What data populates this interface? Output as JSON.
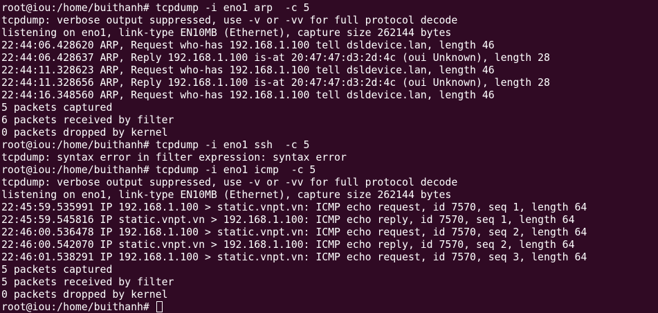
{
  "terminal": {
    "lines": [
      "root@iou:/home/buithanh# tcpdump -i eno1 arp  -c 5",
      "tcpdump: verbose output suppressed, use -v or -vv for full protocol decode",
      "listening on eno1, link-type EN10MB (Ethernet), capture size 262144 bytes",
      "22:44:06.428620 ARP, Request who-has 192.168.1.100 tell dsldevice.lan, length 46",
      "22:44:06.428637 ARP, Reply 192.168.1.100 is-at 20:47:47:d3:2d:4c (oui Unknown), length 28",
      "22:44:11.328623 ARP, Request who-has 192.168.1.100 tell dsldevice.lan, length 46",
      "22:44:11.328656 ARP, Reply 192.168.1.100 is-at 20:47:47:d3:2d:4c (oui Unknown), length 28",
      "22:44:16.348560 ARP, Request who-has 192.168.1.100 tell dsldevice.lan, length 46",
      "5 packets captured",
      "6 packets received by filter",
      "0 packets dropped by kernel",
      "root@iou:/home/buithanh# tcpdump -i eno1 ssh  -c 5",
      "tcpdump: syntax error in filter expression: syntax error",
      "root@iou:/home/buithanh# tcpdump -i eno1 icmp  -c 5",
      "tcpdump: verbose output suppressed, use -v or -vv for full protocol decode",
      "listening on eno1, link-type EN10MB (Ethernet), capture size 262144 bytes",
      "22:45:59.535991 IP 192.168.1.100 > static.vnpt.vn: ICMP echo request, id 7570, seq 1, length 64",
      "22:45:59.545816 IP static.vnpt.vn > 192.168.1.100: ICMP echo reply, id 7570, seq 1, length 64",
      "22:46:00.536478 IP 192.168.1.100 > static.vnpt.vn: ICMP echo request, id 7570, seq 2, length 64",
      "22:46:00.542070 IP static.vnpt.vn > 192.168.1.100: ICMP echo reply, id 7570, seq 2, length 64",
      "22:46:01.538291 IP 192.168.1.100 > static.vnpt.vn: ICMP echo request, id 7570, seq 3, length 64",
      "5 packets captured",
      "5 packets received by filter",
      "0 packets dropped by kernel"
    ],
    "prompt": "root@iou:/home/buithanh# ",
    "colors": {
      "background": "#300a24",
      "foreground": "#ffffff"
    }
  }
}
